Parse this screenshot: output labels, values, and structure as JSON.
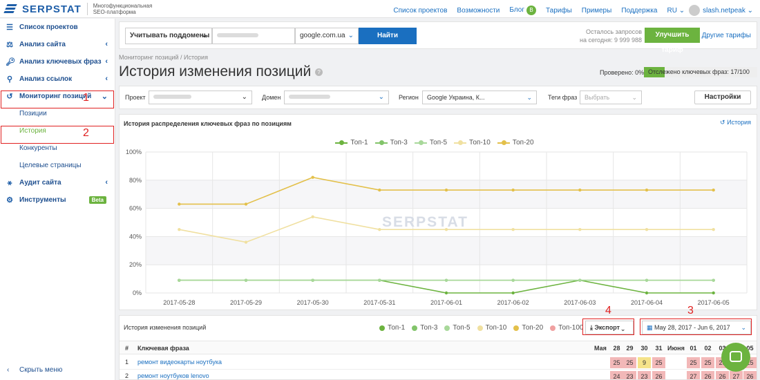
{
  "brand": {
    "name": "SERPSTAT",
    "tagline": "Многофункциональная SEO-платформа"
  },
  "topnav": {
    "items": [
      "Список проектов",
      "Возможности",
      "Блог",
      "Тарифы",
      "Примеры",
      "Поддержка"
    ],
    "blog_badge": "B",
    "lang": "RU",
    "user": "slash.netpeak"
  },
  "sidebar": {
    "items": [
      {
        "label": "Список проектов",
        "icon": "menu-icon"
      },
      {
        "label": "Анализ сайта",
        "icon": "analysis-icon"
      },
      {
        "label": "Анализ ключевых фраз",
        "icon": "key-icon"
      },
      {
        "label": "Анализ ссылок",
        "icon": "link-icon"
      },
      {
        "label": "Мониторинг позиций",
        "icon": "history-icon"
      }
    ],
    "subitems": [
      "Позиции",
      "История",
      "Конкуренты",
      "Целевые страницы"
    ],
    "bottom_items": [
      {
        "label": "Аудит сайта",
        "icon": "sitemap-icon"
      },
      {
        "label": "Инструменты",
        "icon": "gear-icon"
      }
    ],
    "beta": "Beta",
    "collapse": "Скрыть меню",
    "annotations": [
      "1",
      "2"
    ]
  },
  "search": {
    "subdomain_select": "Учитывать поддомены",
    "domain_value": "",
    "engine": "google.com.ua",
    "find_label": "Найти",
    "requests_label": "Осталось запросов",
    "requests_today": "на сегодня: 9 999 988",
    "upgrade_label": "Улучшить тариф",
    "other_plans": "Другие тарифы"
  },
  "page": {
    "breadcrumb": "Мониторинг позиций / История",
    "title": "История изменения позиций",
    "checked": "Проверено: 0%",
    "tracked": "Отслежено ключевых фраз: 17/100"
  },
  "filters": {
    "project_label": "Проект",
    "domain_label": "Домен",
    "region_label": "Регион",
    "region_value": "Google Украина, К...",
    "tags_label": "Теги фраз",
    "tags_placeholder": "Выбрать",
    "settings_label": "Настройки"
  },
  "chart_panel": {
    "title": "История распределения ключевых фраз по позициям",
    "history_link": "История",
    "watermark": "SERPSTAT"
  },
  "chart_data": {
    "type": "line",
    "x": [
      "2017-05-28",
      "2017-05-29",
      "2017-05-30",
      "2017-05-31",
      "2017-06-01",
      "2017-06-02",
      "2017-06-03",
      "2017-06-04",
      "2017-06-05"
    ],
    "ylim": [
      0,
      100
    ],
    "yticks": [
      "0%",
      "20%",
      "40%",
      "60%",
      "80%",
      "100%"
    ],
    "series": [
      {
        "name": "Топ-1",
        "color": "#6cb33f",
        "values": [
          9,
          9,
          9,
          9,
          0,
          0,
          9,
          0,
          0
        ]
      },
      {
        "name": "Топ-3",
        "color": "#82c46a",
        "values": [
          9,
          9,
          9,
          9,
          9,
          9,
          9,
          9,
          9
        ]
      },
      {
        "name": "Топ-5",
        "color": "#a8d89a",
        "values": [
          9,
          9,
          9,
          9,
          9,
          9,
          9,
          9,
          9
        ]
      },
      {
        "name": "Топ-10",
        "color": "#f0e0a0",
        "values": [
          45,
          36,
          54,
          45,
          45,
          45,
          45,
          45,
          45
        ]
      },
      {
        "name": "Топ-20",
        "color": "#e3c04a",
        "values": [
          63,
          63,
          82,
          73,
          73,
          73,
          73,
          73,
          73
        ]
      }
    ]
  },
  "table_panel": {
    "title": "История изменения позиций",
    "legend": [
      {
        "name": "Топ-1",
        "color": "#6cb33f"
      },
      {
        "name": "Топ-3",
        "color": "#82c46a"
      },
      {
        "name": "Топ-5",
        "color": "#a8d89a"
      },
      {
        "name": "Топ-10",
        "color": "#f0e0a0"
      },
      {
        "name": "Топ-20",
        "color": "#e3c04a"
      },
      {
        "name": "Топ-100",
        "color": "#f0a0a0"
      }
    ],
    "export_label": "Экспорт",
    "date_range": "May 28, 2017 - Jun 6, 2017",
    "annotations": [
      "4",
      "3"
    ],
    "headers": {
      "num": "#",
      "phrase": "Ключевая фраза",
      "month1": "Мая",
      "days1": [
        "28",
        "29",
        "30",
        "31"
      ],
      "month2": "Июня",
      "days2": [
        "01",
        "02",
        "03",
        "04",
        "05"
      ]
    },
    "rows": [
      {
        "n": "1",
        "phrase": "ремонт видеокарты ноутбука",
        "v1": [
          "25",
          "25",
          "9",
          "25"
        ],
        "v2": [
          "25",
          "25",
          "25",
          "25",
          "25"
        ]
      },
      {
        "n": "2",
        "phrase": "ремонт ноутбуков lenovo",
        "v1": [
          "24",
          "23",
          "23",
          "26"
        ],
        "v2": [
          "27",
          "26",
          "26",
          "27",
          "26"
        ]
      }
    ]
  }
}
